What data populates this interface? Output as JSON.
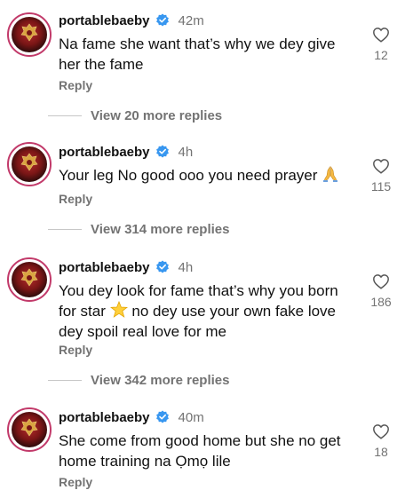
{
  "comments": [
    {
      "username": "portablebaeby",
      "time": "42m",
      "text": "Na fame she want that’s why we dey give her the fame",
      "likes": "12",
      "reply_label": "Reply",
      "view_more": "View 20 more replies"
    },
    {
      "username": "portablebaeby",
      "time": "4h",
      "text": "Your leg No good ooo you need prayer",
      "emoji": "praying-hands-emoji",
      "likes": "115",
      "reply_label": "Reply",
      "view_more": "View 314 more replies"
    },
    {
      "username": "portablebaeby",
      "time": "4h",
      "text_before": "You dey look for fame that’s why you born for star",
      "emoji": "star-emoji",
      "text_after": "no dey use your own fake love dey spoil real love for me",
      "likes": "186",
      "reply_label": "Reply",
      "view_more": "View 342 more replies"
    },
    {
      "username": "portablebaeby",
      "time": "40m",
      "text": "She come from good home but she no get home training na Ọmọ lile",
      "likes": "18",
      "reply_label": "Reply"
    }
  ],
  "colors": {
    "verified": "#3897f0",
    "muted": "#737373",
    "avatar_ring": "#c23a6a"
  }
}
